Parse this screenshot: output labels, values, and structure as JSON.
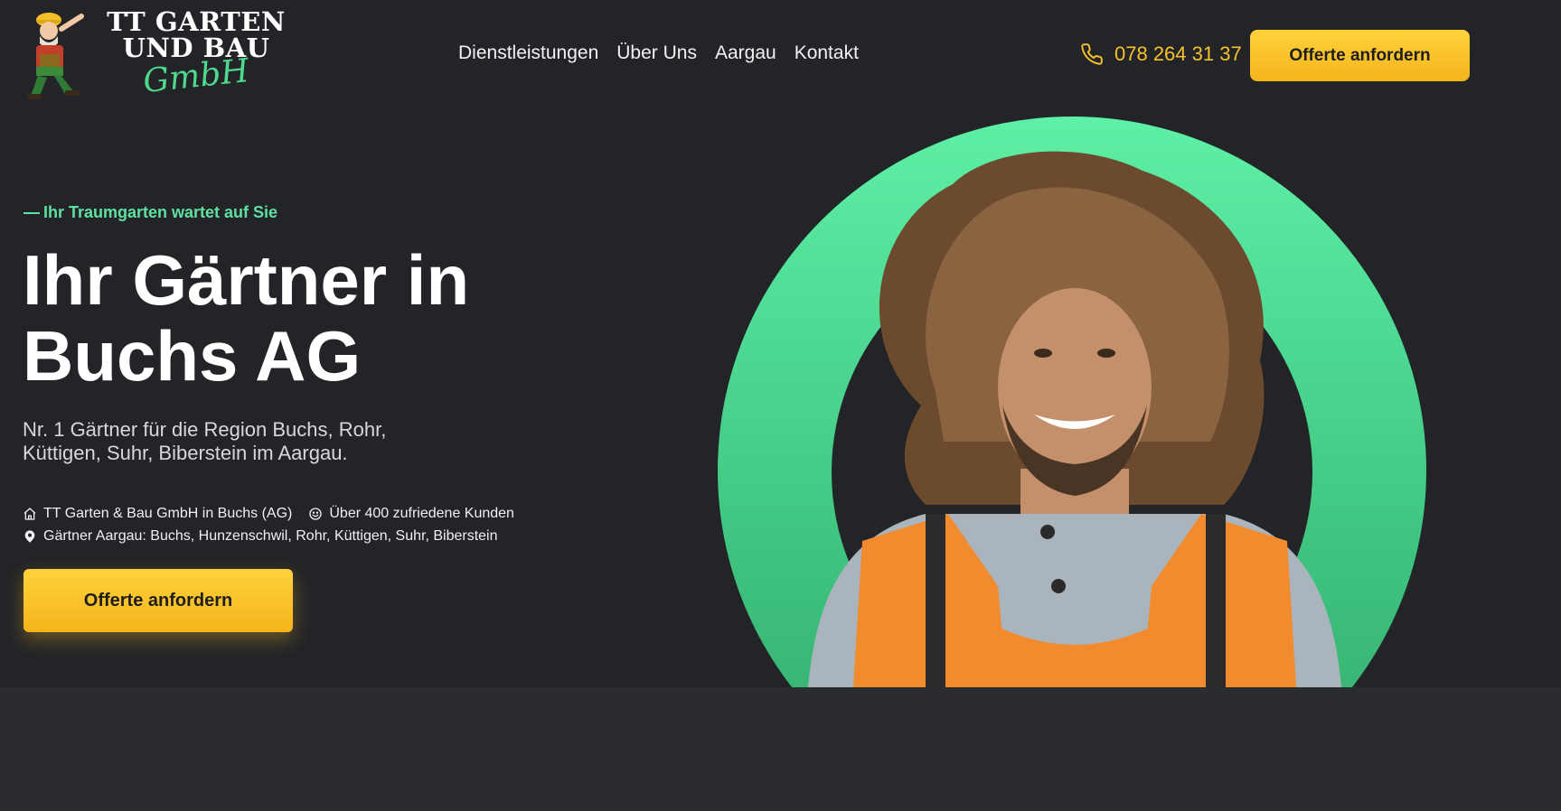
{
  "header": {
    "logo": {
      "line1": "TT GARTEN",
      "line2": "UND BAU",
      "line3": "GmbH"
    },
    "nav": [
      "Dienstleistungen",
      "Über Uns",
      "Aargau",
      "Kontakt"
    ],
    "phone": "078 264 31 37",
    "cta": "Offerte anfordern",
    "icons": {
      "phone": "phone-icon",
      "logo": "gardener-mascot-logo"
    }
  },
  "hero": {
    "tagline": "Ihr Traumgarten wartet auf Sie",
    "headline_line1": "Ihr Gärtner in",
    "headline_line2": "Buchs AG",
    "subline": "Nr. 1 Gärtner für die Region Buchs, Rohr, Küttigen, Suhr, Biberstein im Aargau.",
    "facts": {
      "company": "TT Garten & Bau GmbH in Buchs (AG)",
      "customers": "Über 400 zufriedene Kunden",
      "regions": "Gärtner Aargau: Buchs, Hunzenschwil,  Rohr, Küttigen, Suhr, Biberstein"
    },
    "cta": "Offerte anfordern",
    "image": "smiling-gardener-in-orange-safety-vest"
  },
  "colors": {
    "background": "#232428",
    "accent_yellow": "#f6c12a",
    "accent_green": "#5fe0a0"
  }
}
